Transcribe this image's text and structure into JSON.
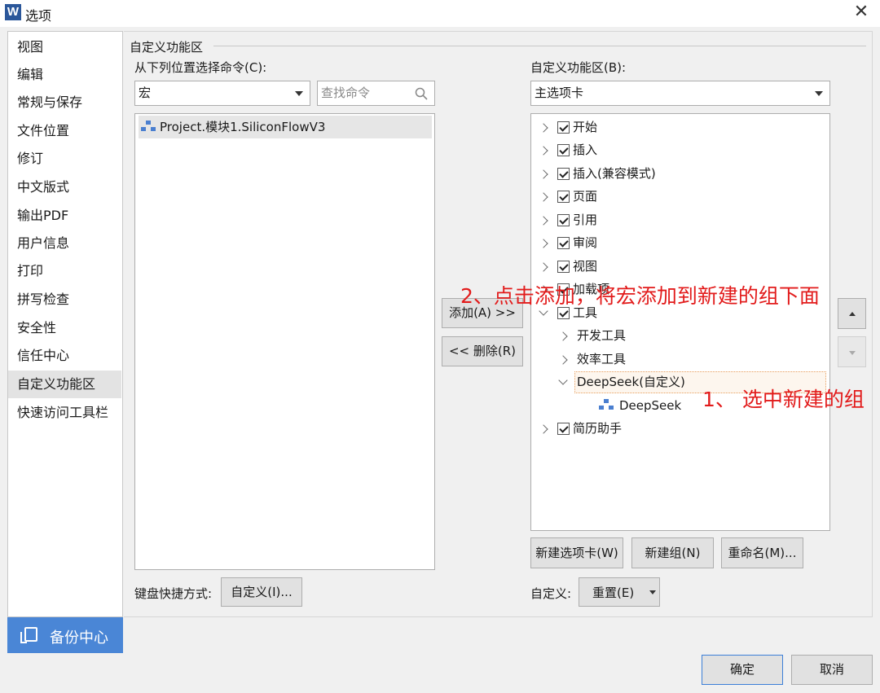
{
  "window": {
    "app_icon": "W",
    "title": "选项",
    "close": "✕"
  },
  "nav": {
    "items": [
      "视图",
      "编辑",
      "常规与保存",
      "文件位置",
      "修订",
      "中文版式",
      "输出PDF",
      "用户信息",
      "打印",
      "拼写检查",
      "安全性",
      "信任中心",
      "自定义功能区",
      "快速访问工具栏"
    ],
    "selected": "自定义功能区",
    "backup_label": "备份中心"
  },
  "section_title": "自定义功能区",
  "left": {
    "choose_label": "从下列位置选择命令(C):",
    "source_value": "宏",
    "search_placeholder": "查找命令",
    "commands": [
      "Project.模块1.SiliconFlowV3"
    ]
  },
  "middle": {
    "add_label": "添加(A) >>",
    "remove_label": "<< 删除(R)"
  },
  "right": {
    "customize_label": "自定义功能区(B):",
    "tabs_value": "主选项卡",
    "tree": [
      {
        "label": "开始"
      },
      {
        "label": "插入"
      },
      {
        "label": "插入(兼容模式)"
      },
      {
        "label": "页面"
      },
      {
        "label": "引用"
      },
      {
        "label": "审阅"
      },
      {
        "label": "视图"
      },
      {
        "label": "加载项"
      },
      {
        "label": "工具"
      },
      {
        "label": "开发工具"
      },
      {
        "label": "效率工具"
      },
      {
        "label": "DeepSeek(自定义)"
      },
      {
        "label": "DeepSeek"
      },
      {
        "label": "简历助手"
      }
    ],
    "new_tab_label": "新建选项卡(W)",
    "new_group_label": "新建组(N)",
    "rename_label": "重命名(M)...",
    "customize_short": "自定义:",
    "reset_label": "重置(E)"
  },
  "keyboard": {
    "label": "键盘快捷方式:",
    "button": "自定义(I)..."
  },
  "footer": {
    "ok": "确定",
    "cancel": "取消"
  },
  "annotations": {
    "step1": "1、 选中新建的组",
    "step2": "2、点击添加，将宏添加到新建的组下面"
  },
  "colors": {
    "accent": "#4a86d6",
    "annotation": "#e21b1b"
  }
}
